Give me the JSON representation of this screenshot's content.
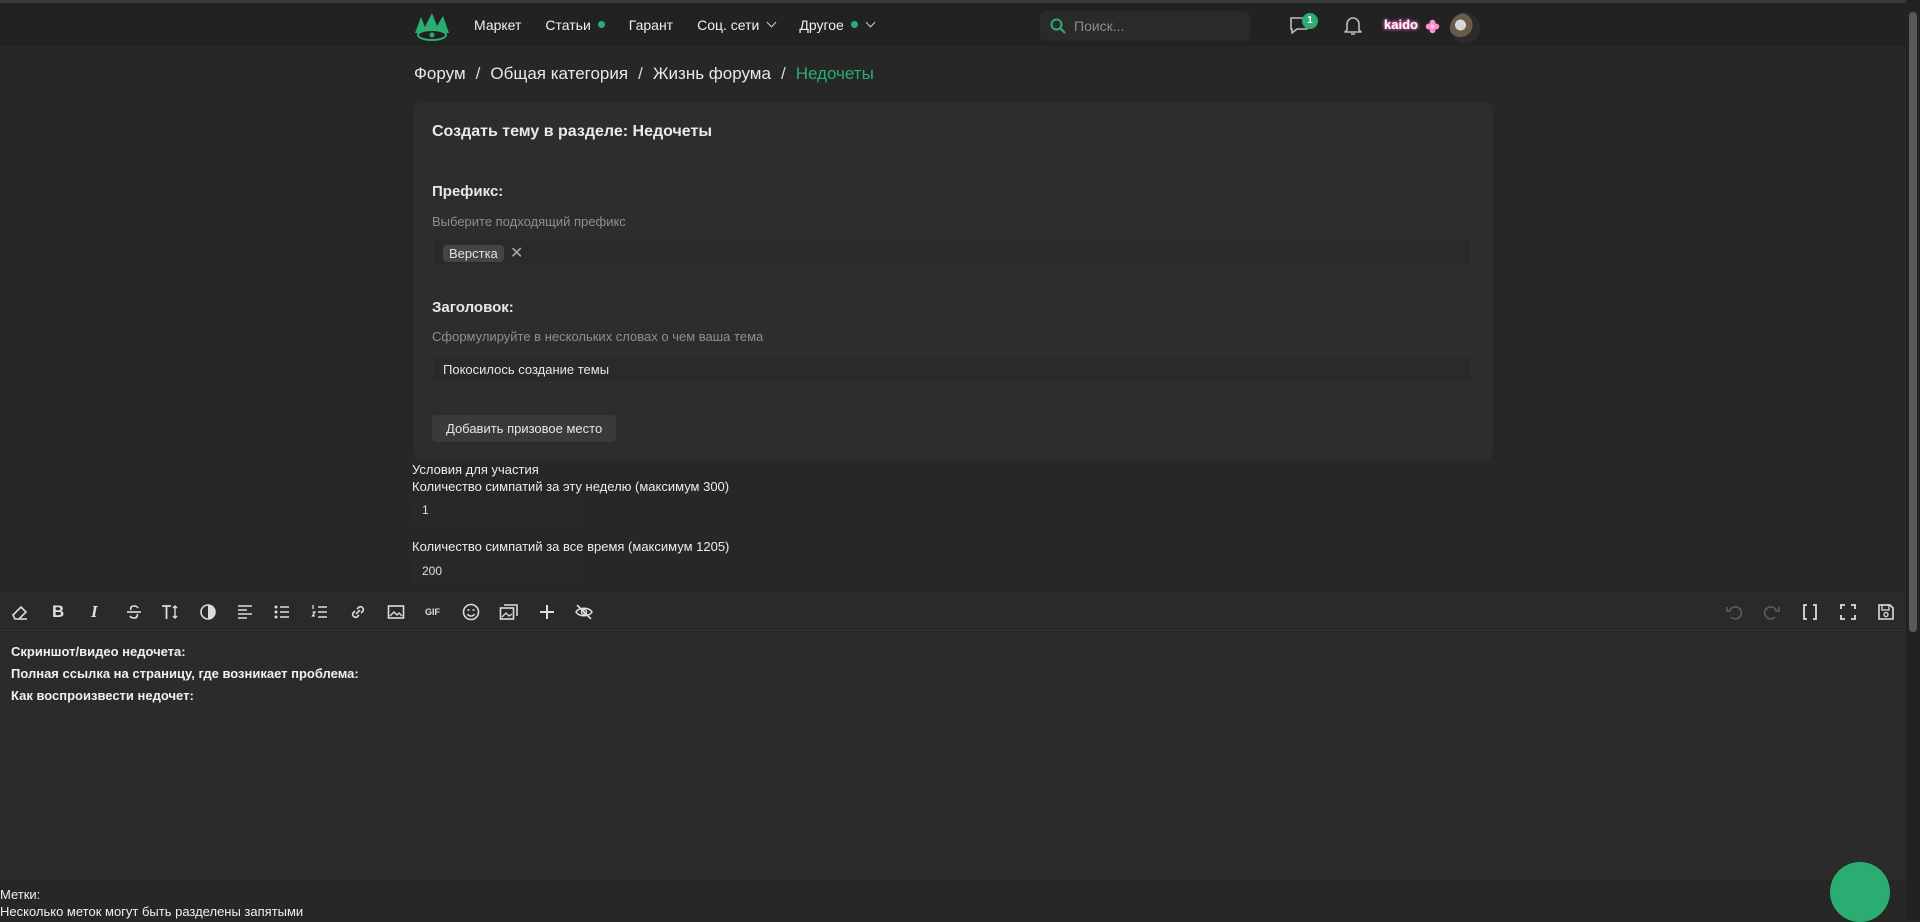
{
  "header": {
    "nav": [
      {
        "label": "Маркет",
        "dot": false,
        "chevron": false
      },
      {
        "label": "Статьи",
        "dot": true,
        "chevron": false
      },
      {
        "label": "Гарант",
        "dot": false,
        "chevron": false
      },
      {
        "label": "Соц. сети",
        "dot": false,
        "chevron": true
      },
      {
        "label": "Другое",
        "dot": true,
        "chevron": true
      }
    ],
    "search_placeholder": "Поиск...",
    "messages_badge": "1",
    "username": "kaido",
    "accent_color": "#2bad72"
  },
  "breadcrumb": {
    "items": [
      "Форум",
      "Общая категория",
      "Жизнь форума"
    ],
    "active": "Недочеты",
    "separator": "/"
  },
  "form": {
    "title": "Создать тему в разделе: Недочеты",
    "prefix_label": "Префикс:",
    "prefix_hint": "Выберите подходящий префикс",
    "prefix_tag": "Верстка",
    "prefix_remove": "✕",
    "heading_label": "Заголовок:",
    "heading_hint": "Сформулируйте в нескольких словах о чем ваша тема",
    "heading_value": "Покосилось создание темы",
    "add_prize_button": "Добавить призовое место"
  },
  "conditions": {
    "title": "Условия для участия",
    "week_label": "Количество симпатий за эту неделю (максимум 300)",
    "week_value": "1",
    "all_label": "Количество симпатий за все время (максимум 1205)",
    "all_value": "200"
  },
  "toolbar": {
    "gif_label": "GIF",
    "bold": "B",
    "italic": "I"
  },
  "editor": {
    "lines": [
      "Скриншот/видео недочета:",
      "Полная ссылка на страницу, где возникает проблема:",
      "Как воспроизвести недочет:"
    ]
  },
  "tags": {
    "label": "Метки:",
    "hint": "Несколько меток могут быть разделены запятыми"
  }
}
